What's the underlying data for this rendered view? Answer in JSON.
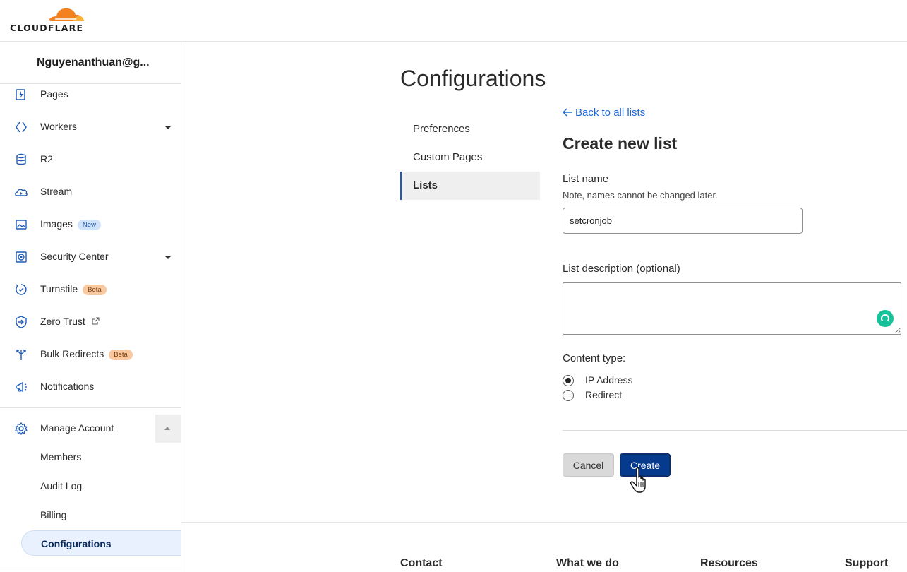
{
  "header": {
    "logo_text": "CLOUDFLARE"
  },
  "sidebar": {
    "account_name": "Nguyenanthuan@g...",
    "items": [
      {
        "label": "Pages",
        "icon": "pages-icon",
        "badge": ""
      },
      {
        "label": "Workers",
        "icon": "workers-icon",
        "badge": ""
      },
      {
        "label": "R2",
        "icon": "r2-database-icon",
        "badge": ""
      },
      {
        "label": "Stream",
        "icon": "stream-cloud-icon",
        "badge": ""
      },
      {
        "label": "Images",
        "icon": "images-icon",
        "badge": "New"
      },
      {
        "label": "Security Center",
        "icon": "security-center-icon",
        "badge": ""
      },
      {
        "label": "Turnstile",
        "icon": "turnstile-icon",
        "badge": "Beta"
      },
      {
        "label": "Zero Trust",
        "icon": "zero-trust-icon",
        "badge": ""
      },
      {
        "label": "Bulk Redirects",
        "icon": "bulk-redirects-icon",
        "badge": "Beta"
      },
      {
        "label": "Notifications",
        "icon": "notifications-icon",
        "badge": ""
      }
    ],
    "manage_account": {
      "label": "Manage Account",
      "sub_items": [
        "Members",
        "Audit Log",
        "Billing",
        "Configurations"
      ]
    }
  },
  "main": {
    "title": "Configurations",
    "subnav": [
      "Preferences",
      "Custom Pages",
      "Lists"
    ],
    "back_link": "Back to all lists",
    "form_title": "Create new list",
    "list_name_label": "List name",
    "list_name_note": "Note, names cannot be changed later.",
    "list_name_value": "setcronjob",
    "description_label": "List description (optional)",
    "description_value": "",
    "content_type_label": "Content type:",
    "content_types": [
      "IP Address",
      "Redirect"
    ],
    "selected_content_type": "IP Address",
    "cancel_label": "Cancel",
    "create_label": "Create"
  },
  "footer": {
    "columns": [
      "Contact",
      "What we do",
      "Resources",
      "Support"
    ]
  },
  "colors": {
    "accent": "#063a8c",
    "link": "#1f68d6",
    "brand_orange": "#f48120"
  }
}
